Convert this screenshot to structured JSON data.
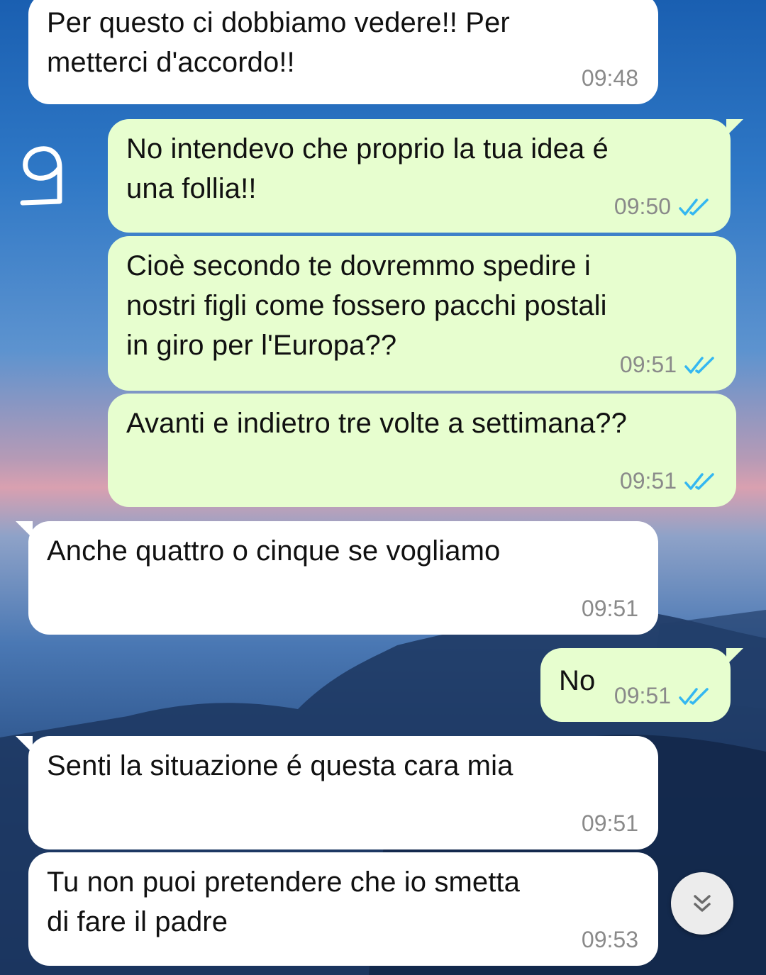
{
  "marker": "9",
  "messages": [
    {
      "direction": "in",
      "text": "Per questo ci dobbiamo vedere!! Per\nmetterci d'accordo!!",
      "time": "09:48"
    },
    {
      "direction": "out",
      "text": "No intendevo che proprio la tua idea é\nuna follia!!",
      "time": "09:50"
    },
    {
      "direction": "out",
      "text": "Cioè secondo te dovremmo spedire i\nnostri figli come fossero pacchi postali\nin giro per l'Europa??",
      "time": "09:51"
    },
    {
      "direction": "out",
      "text": "Avanti e indietro tre volte a settimana??",
      "time": "09:51"
    },
    {
      "direction": "in",
      "text": "Anche quattro o cinque se vogliamo",
      "time": "09:51"
    },
    {
      "direction": "out",
      "text": "No",
      "time": "09:51"
    },
    {
      "direction": "in",
      "text": "Senti la situazione é questa cara mia",
      "time": "09:51"
    },
    {
      "direction": "in",
      "text": "Tu non puoi pretendere che io smetta\ndi fare il padre",
      "time": "09:53"
    }
  ],
  "icons": {
    "read_receipt": "double-check-icon",
    "scroll_down": "double-chevron-down-icon",
    "marker": "handwritten-nine"
  },
  "colors": {
    "incoming_bubble": "#ffffff",
    "outgoing_bubble": "#e7fecf",
    "read_check": "#34b7f1",
    "timestamp": "#8a8a8a",
    "marker": "#ffffff"
  }
}
